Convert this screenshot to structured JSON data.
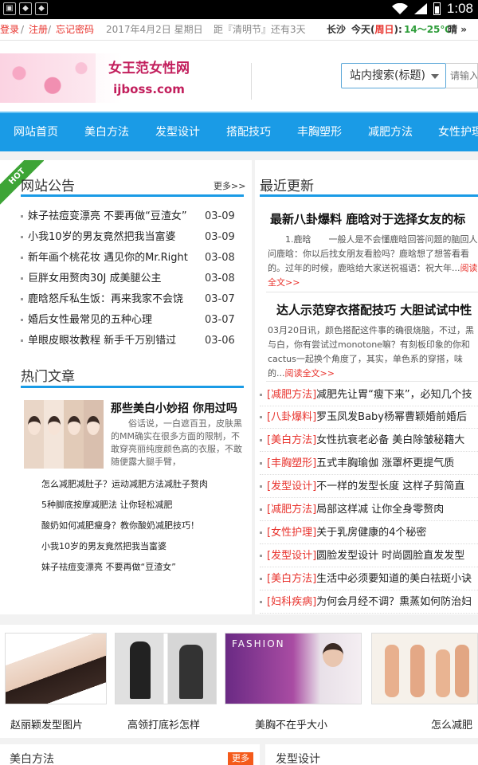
{
  "status_bar": {
    "time": "1:08"
  },
  "topbar": {
    "login": "登录",
    "sep1": " / ",
    "register": "注册",
    "sep2": " / ",
    "forgot": "忘记密码",
    "date": "2017年4月2日 星期日",
    "countdown": "距『清明节』还有3天",
    "city": "长沙",
    "today_prefix": "今天(",
    "weekday": "周日",
    "today_suffix": "):",
    "temp": "14～25℃",
    "weather": "晴",
    "more_arrow": "»"
  },
  "header": {
    "logo_title": "女王范女性网",
    "logo_url": "ijboss.com",
    "search_type": "站内搜索(标题)",
    "search_placeholder": "请输入"
  },
  "nav": [
    "网站首页",
    "美白方法",
    "发型设计",
    "搭配技巧",
    "丰胸塑形",
    "减肥方法",
    "女性护理"
  ],
  "notice": {
    "ribbon": "HOT",
    "title": "网站公告",
    "more": "更多>>",
    "items": [
      {
        "text": "妹子祛痘变漂亮 不要再做“豆渣女”",
        "date": "03-09"
      },
      {
        "text": "小我10岁的男友竟然把我当富婆",
        "date": "03-09"
      },
      {
        "text": "新年画个桃花妆 遇见你的Mr.Right",
        "date": "03-08"
      },
      {
        "text": "巨胖女用赘肉30J 成美腿公主",
        "date": "03-08"
      },
      {
        "text": "鹿晗怒斥私生饭：再来我家不会饶",
        "date": "03-07"
      },
      {
        "text": "婚后女性最常见的五种心理",
        "date": "03-07"
      },
      {
        "text": "单眼皮眼妆教程 新手千万别错过",
        "date": "03-06"
      }
    ]
  },
  "hot": {
    "title": "热门文章",
    "feature_title": "那些美白小妙招 你用过吗",
    "feature_body": "俗话说，一白遮百丑，皮肤黑的MM确实在很多方面的限制，不敢穿亮丽纯度颜色高的衣服，不敢随便露大腿手臂，",
    "links": [
      "怎么减肥减肚子？运动减肥方法减肚子赘肉",
      "5种脚底按摩减肥法 让你轻松减肥",
      "酸奶如何减肥瘦身？教你酸奶减肥技巧！",
      "小我10岁的男友竟然把我当富婆",
      "妹子祛痘变漂亮 不要再做“豆渣女”"
    ]
  },
  "latest": {
    "title": "最近更新",
    "news": [
      {
        "title": "最新八卦爆料 鹿晗对于选择女友的标",
        "body": "1.鹿晗　　一般人是不会懂鹿晗回答问题的脑回人问鹿晗：你以后找女朋友看脸吗？鹿晗想了想答看看的。过年的时候，鹿晗给大家送祝福语：祝大年...",
        "read": "阅读全文>>"
      },
      {
        "title": "达人示范穿衣搭配技巧 大胆试试中性",
        "body": "03月20日讯，颜色搭配这件事的确很烧脑，不过，黑与白，你有尝试过monotone嘛？有刻板印象的你和cactus一起换个角度了，其实，单色系的穿搭，味的...",
        "read": "阅读全文>>"
      }
    ],
    "items": [
      {
        "tag": "[减肥方法]",
        "text": "减肥先让胃“瘦下来”，必知几个技"
      },
      {
        "tag": "[八卦爆料]",
        "text": "罗玉凤发Baby杨幂曹颖婚前婚后"
      },
      {
        "tag": "[美白方法]",
        "text": "女性抗衰老必备 美白除皱秘籍大"
      },
      {
        "tag": "[丰胸塑形]",
        "text": "五式丰胸瑜伽 涨罩杯更提气质"
      },
      {
        "tag": "[发型设计]",
        "text": "不一样的发型长度 这样子剪简直"
      },
      {
        "tag": "[减肥方法]",
        "text": "局部这样减 让你全身零赘肉"
      },
      {
        "tag": "[女性护理]",
        "text": "关于乳房健康的4个秘密"
      },
      {
        "tag": "[发型设计]",
        "text": "圆脸发型设计 时尚圆脸直发发型"
      },
      {
        "tag": "[美白方法]",
        "text": "生活中必须要知道的美白祛斑小诀"
      },
      {
        "tag": "[妇科疾病]",
        "text": "为何会月经不调？熏蒸如何防治妇"
      }
    ]
  },
  "gallery": [
    {
      "caption": "赵丽颖发型图片"
    },
    {
      "caption": "高领打底衫怎样"
    },
    {
      "caption": "美胸不在乎大小"
    },
    {
      "caption": "怎么减肥"
    }
  ],
  "bottom": {
    "left_title": "美白方法",
    "more_btn": "更多",
    "right_title": "发型设计"
  }
}
